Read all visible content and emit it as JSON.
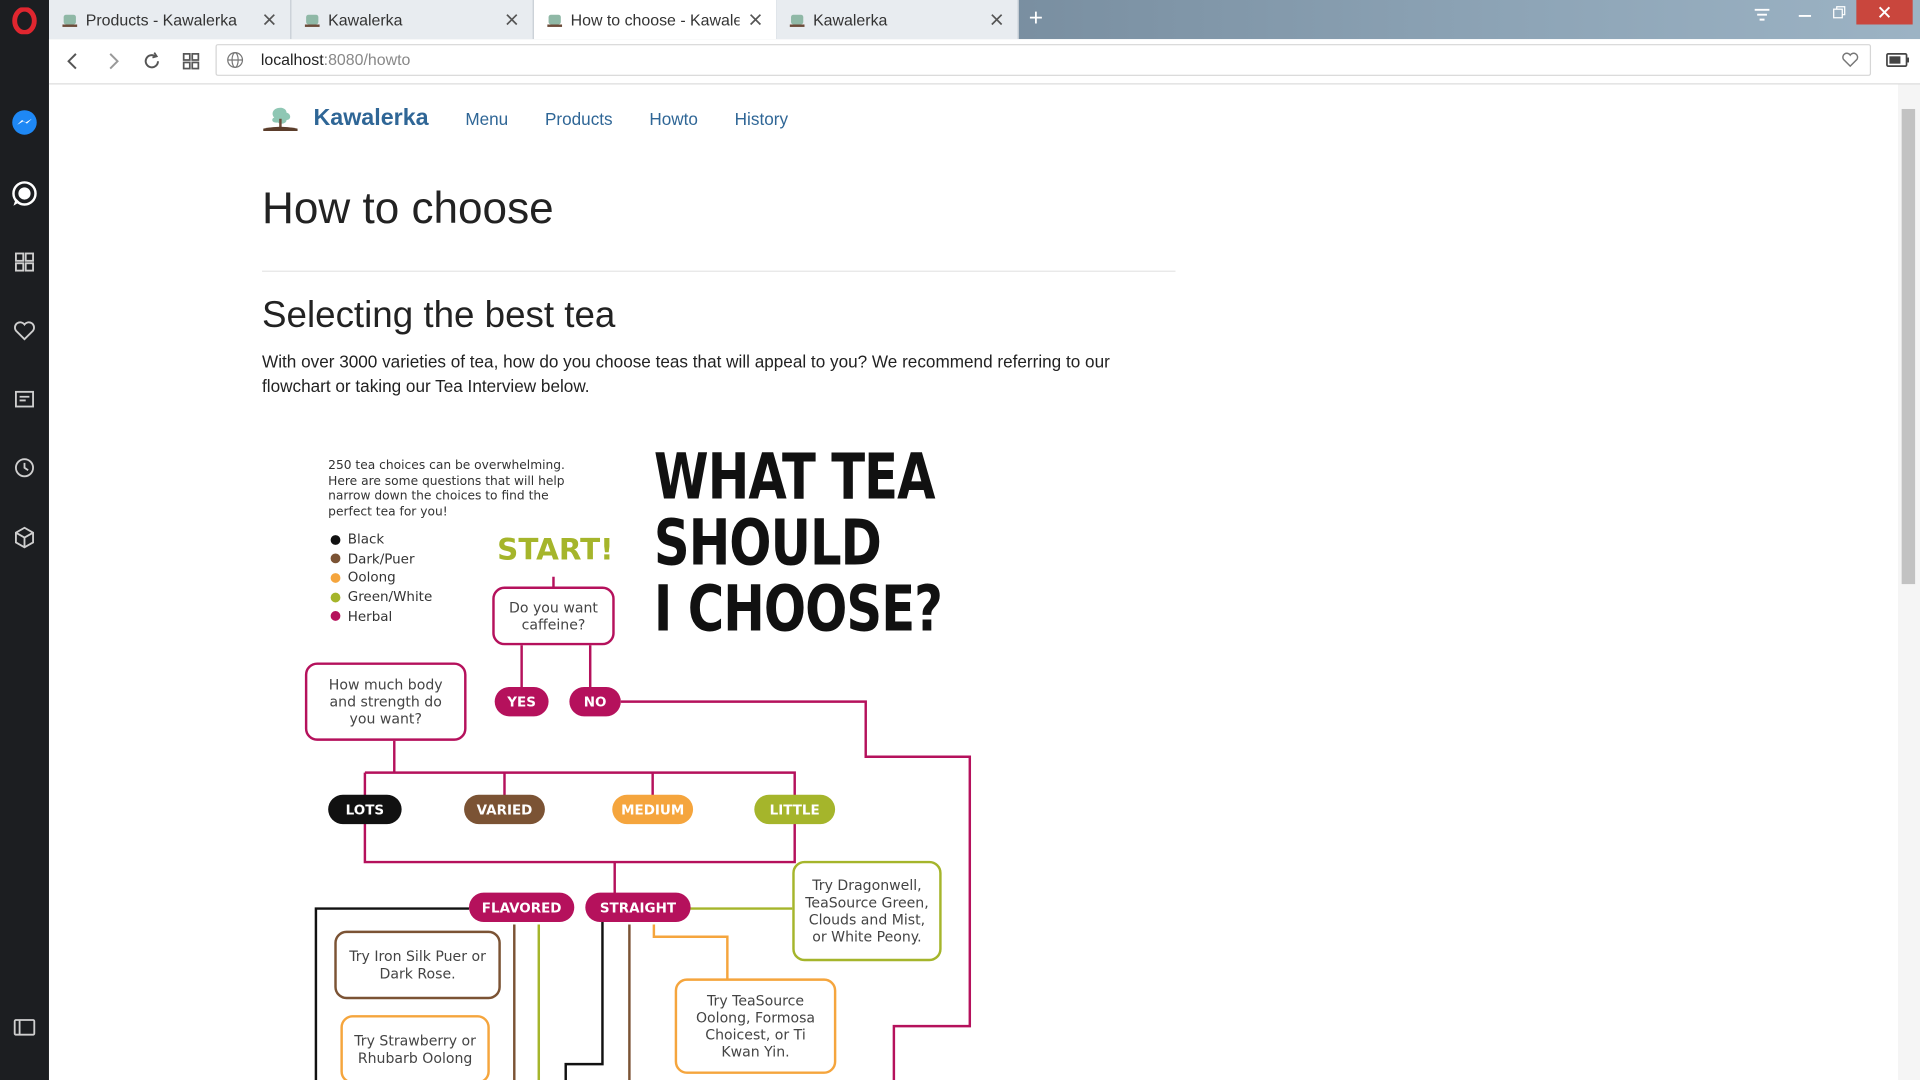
{
  "browser": {
    "tabs": [
      {
        "title": "Products - Kawalerka",
        "active": false
      },
      {
        "title": "Kawalerka",
        "active": false
      },
      {
        "title": "How to choose - Kawalerka",
        "active": true
      },
      {
        "title": "Kawalerka",
        "active": false
      }
    ],
    "new_tab_label": "+",
    "address": {
      "host": "localhost",
      "rest": ":8080/howto"
    },
    "sidebar_icons": [
      "opera-logo-icon",
      "messenger-icon",
      "whatsapp-icon",
      "speed-dial-icon",
      "heart-icon",
      "news-icon",
      "history-icon",
      "extensions-icon",
      "sidebar-toggle-icon"
    ]
  },
  "site": {
    "brand": "Kawalerka",
    "nav": [
      "Menu",
      "Products",
      "Howto",
      "History"
    ]
  },
  "page": {
    "title": "How to choose",
    "subtitle": "Selecting the best tea",
    "intro": "With over 3000 varieties of tea, how do you choose teas that will appeal to you? We recommend referring to our flowchart or taking our Tea Interview below."
  },
  "flowchart": {
    "intro_note": "250 tea choices can be overwhelming. Here are some questions that will help narrow down the choices to find the perfect tea for you!",
    "legend": [
      {
        "label": "Black",
        "color": "#111111"
      },
      {
        "label": "Dark/Puer",
        "color": "#7b5334"
      },
      {
        "label": "Oolong",
        "color": "#f5a53d"
      },
      {
        "label": "Green/White",
        "color": "#a5b52b"
      },
      {
        "label": "Herbal",
        "color": "#b5115c"
      }
    ],
    "headline": [
      "WHAT TEA",
      "SHOULD",
      "I CHOOSE?"
    ],
    "start": "START!",
    "q_caffeine": "Do you want caffeine?",
    "yes": "YES",
    "no": "NO",
    "q_body": "How much body and strength do you want?",
    "lots": "LOTS",
    "varied": "VARIED",
    "medium": "MEDIUM",
    "little": "LITTLE",
    "flavored": "FLAVORED",
    "straight": "STRAIGHT",
    "try_green": "Try Dragonwell, TeaSource Green, Clouds and Mist, or White Peony.",
    "try_iron": "Try Iron Silk Puer or Dark Rose.",
    "try_oolong": "Try TeaSource Oolong, Formosa Choicest, or Ti Kwan Yin.",
    "try_strawberry": "Try Strawberry or Rhubarb Oolong"
  }
}
